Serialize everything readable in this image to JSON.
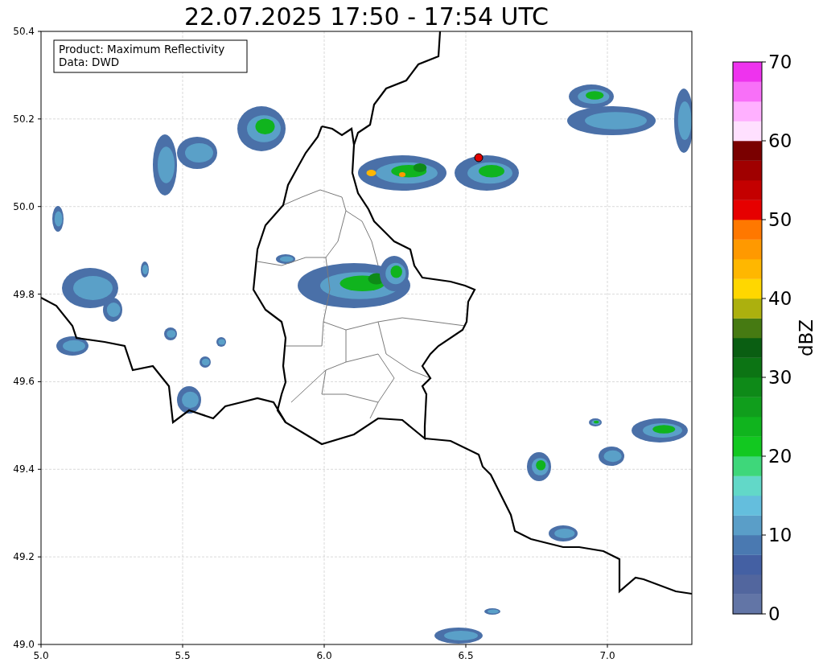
{
  "title": "22.07.2025 17:50 - 17:54 UTC",
  "annotation": [
    "Product: Maximum Reflectivity",
    "Data: DWD"
  ],
  "x_ticks": [
    "5.0",
    "5.5",
    "6.0",
    "6.5",
    "7.0"
  ],
  "y_ticks": [
    "50.4",
    "50.2",
    "50.0",
    "49.8",
    "49.6",
    "49.4",
    "49.2",
    "49.0"
  ],
  "colorbar": {
    "label": "dBZ",
    "ticks": [
      "70",
      "60",
      "50",
      "40",
      "30",
      "20",
      "10",
      "0"
    ],
    "segments": [
      {
        "color": "#6275a6"
      },
      {
        "color": "#52669e"
      },
      {
        "color": "#4460a3"
      },
      {
        "color": "#4a79b1"
      },
      {
        "color": "#5a9ec8"
      },
      {
        "color": "#64bedd"
      },
      {
        "color": "#62d8c8"
      },
      {
        "color": "#3ed77a"
      },
      {
        "color": "#12c820"
      },
      {
        "color": "#10b41e"
      },
      {
        "color": "#109e1c"
      },
      {
        "color": "#0e8a18"
      },
      {
        "color": "#0c7414"
      },
      {
        "color": "#0a5e12"
      },
      {
        "color": "#467a12"
      },
      {
        "color": "#acb00e"
      },
      {
        "color": "#ffd700"
      },
      {
        "color": "#ffb700"
      },
      {
        "color": "#ff9900"
      },
      {
        "color": "#ff7800"
      },
      {
        "color": "#e60000"
      },
      {
        "color": "#c40000"
      },
      {
        "color": "#a00000"
      },
      {
        "color": "#7a0000"
      },
      {
        "color": "#ffe0ff"
      },
      {
        "color": "#ffb0ff"
      },
      {
        "color": "#f870f8"
      },
      {
        "color": "#ee33ee"
      }
    ]
  }
}
